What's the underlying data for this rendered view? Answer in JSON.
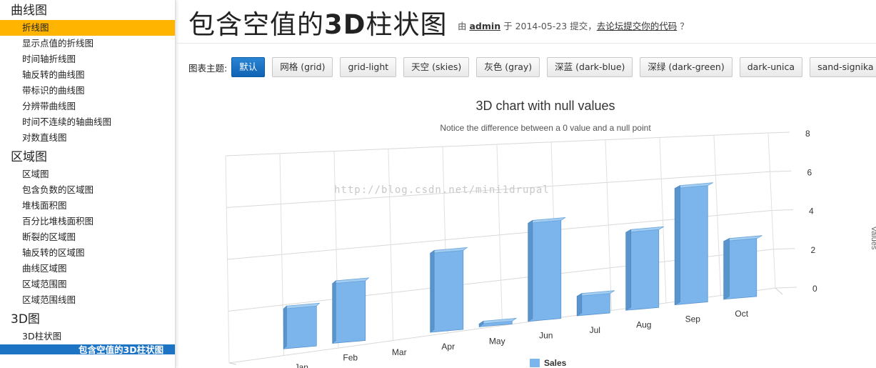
{
  "sidebar": {
    "sections": [
      {
        "title": "曲线图",
        "items": [
          {
            "label": "折线图",
            "state": "active"
          },
          {
            "label": "显示点值的折线图"
          },
          {
            "label": "时间轴折线图"
          },
          {
            "label": "轴反转的曲线图"
          },
          {
            "label": "带标识的曲线图"
          },
          {
            "label": "分辨带曲线图"
          },
          {
            "label": "时间不连续的轴曲线图"
          },
          {
            "label": "对数直线图"
          }
        ]
      },
      {
        "title": "区域图",
        "items": [
          {
            "label": "区域图"
          },
          {
            "label": "包含负数的区域图"
          },
          {
            "label": "堆栈面积图"
          },
          {
            "label": "百分比堆栈面积图"
          },
          {
            "label": "断裂的区域图"
          },
          {
            "label": "轴反转的区域图"
          },
          {
            "label": "曲线区域图"
          },
          {
            "label": "区域范围图"
          },
          {
            "label": "区域范围线图"
          }
        ]
      },
      {
        "title": "3D图",
        "items": [
          {
            "label": "3D柱状图"
          },
          {
            "label": "包含空值的3D柱状图",
            "state": "current"
          }
        ]
      }
    ]
  },
  "header": {
    "title_prefix": "包含空值的",
    "title_bold": "3D",
    "title_suffix": "柱状图",
    "by": "由",
    "user": "admin",
    "at": "于",
    "date": "2014-05-23",
    "submitted": "提交，",
    "forum_link": "去论坛提交你的代码",
    "question": "？"
  },
  "themes": {
    "label": "图表主题:",
    "buttons": [
      {
        "label": "默认",
        "selected": true
      },
      {
        "label": "网格 (grid)"
      },
      {
        "label": "grid-light"
      },
      {
        "label": "天空 (skies)"
      },
      {
        "label": "灰色 (gray)"
      },
      {
        "label": "深蓝 (dark-blue)"
      },
      {
        "label": "深绿 (dark-green)"
      },
      {
        "label": "dark-unica"
      },
      {
        "label": "sand-signika"
      }
    ]
  },
  "watermark": "http://blog.csdn.net/mini1drupal",
  "chart_data": {
    "type": "bar",
    "title": "3D chart with null values",
    "subtitle": "Notice the difference between a 0 value and a null point",
    "categories": [
      "Jan",
      "Feb",
      "Mar",
      "Apr",
      "May",
      "Jun",
      "Jul",
      "Aug",
      "Sep",
      "Oct"
    ],
    "series": [
      {
        "name": "Sales",
        "values": [
          2,
          3,
          null,
          4,
          0,
          5,
          1,
          4,
          6,
          3
        ],
        "color": "#7cb5ec"
      }
    ],
    "ylabel": "Values",
    "ylim": [
      0,
      8
    ],
    "yticks": [
      "0",
      "2",
      "4",
      "6",
      "8"
    ],
    "grid": true,
    "legend": "bottom-center",
    "options3d": true
  }
}
